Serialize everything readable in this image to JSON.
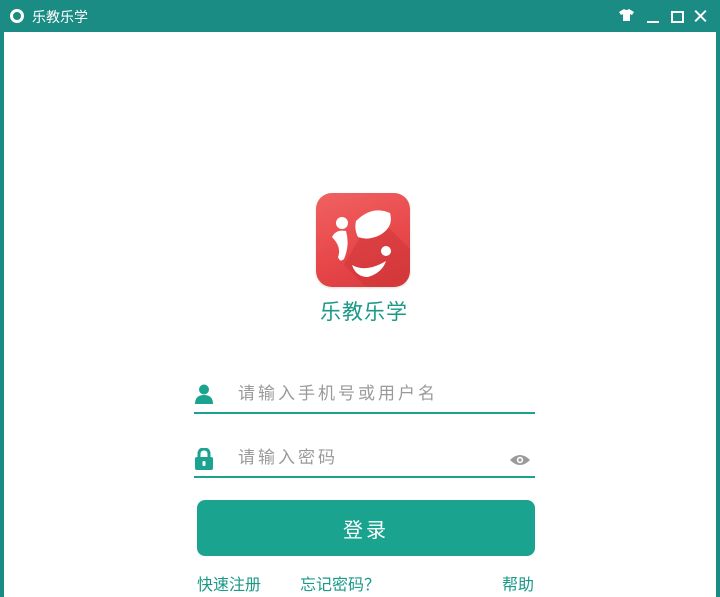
{
  "window": {
    "title": "乐教乐学",
    "accent_color": "#1a8c84",
    "controls": [
      "skin-icon",
      "minimize-icon",
      "maximize-icon",
      "close-icon"
    ]
  },
  "brand": {
    "name": "乐教乐学",
    "logo_color": "#e8484a"
  },
  "login": {
    "username_placeholder": "请输入手机号或用户名",
    "password_placeholder": "请输入密码",
    "submit_label": "登录",
    "button_color": "#1aa38f"
  },
  "links": {
    "register": "快速注册",
    "forgot": "忘记密码？",
    "help": "帮助"
  }
}
